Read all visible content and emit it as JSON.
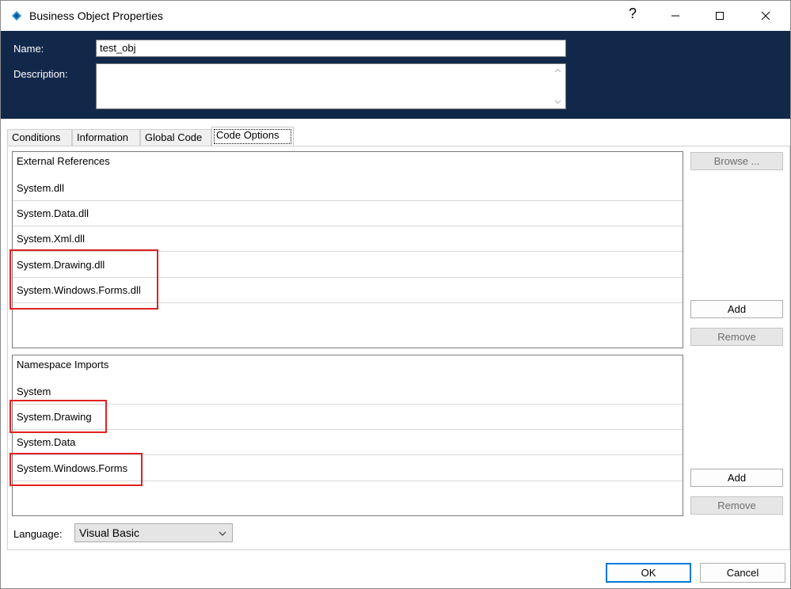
{
  "window": {
    "title": "Business Object Properties",
    "help_glyph": "?",
    "minimize_glyph": "—",
    "maximize_glyph": "☐",
    "close_glyph": "✕"
  },
  "header": {
    "name_label": "Name:",
    "name_value": "test_obj",
    "description_label": "Description:",
    "description_value": "",
    "bg_color": "#12284b"
  },
  "tabs": [
    {
      "label": "Conditions"
    },
    {
      "label": "Information"
    },
    {
      "label": "Global Code"
    },
    {
      "label": "Code Options",
      "active": true
    }
  ],
  "external_references": {
    "header": "External References",
    "items": [
      "System.dll",
      "System.Data.dll",
      "System.Xml.dll",
      "System.Drawing.dll",
      "System.Windows.Forms.dll"
    ],
    "browse_label": "Browse ...",
    "add_label": "Add",
    "remove_label": "Remove"
  },
  "namespace_imports": {
    "header": "Namespace Imports",
    "items": [
      "System",
      "System.Drawing",
      "System.Data",
      "System.Windows.Forms"
    ],
    "add_label": "Add",
    "remove_label": "Remove"
  },
  "language": {
    "label": "Language:",
    "value": "Visual Basic"
  },
  "footer": {
    "ok_label": "OK",
    "cancel_label": "Cancel"
  },
  "colors": {
    "highlight": "#e02020",
    "default_button_border": "#0078d7"
  }
}
